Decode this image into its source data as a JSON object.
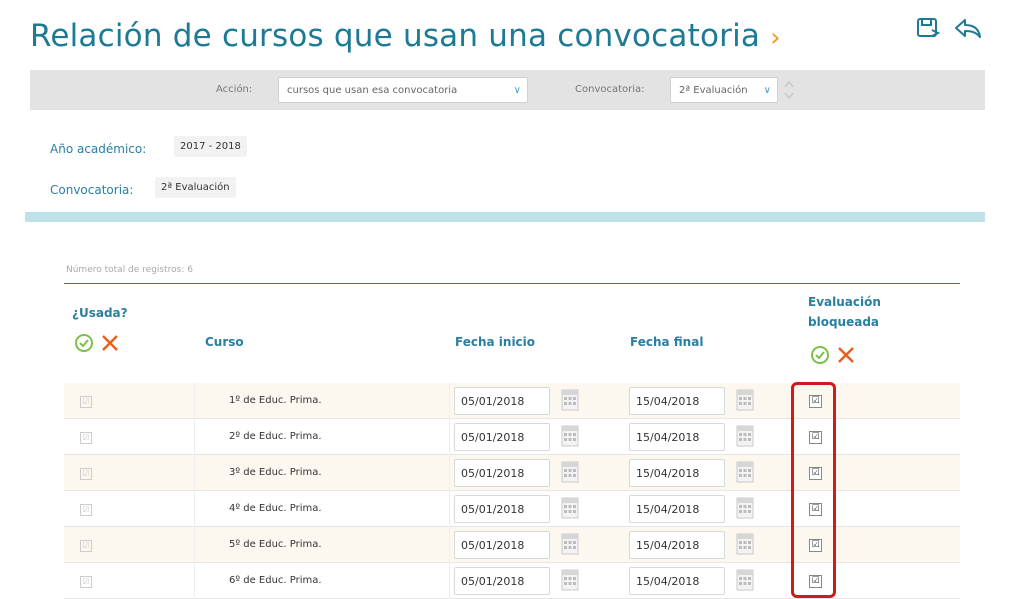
{
  "header": {
    "title": "Relación de cursos que usan una convocatoria",
    "chevron": "›"
  },
  "icons": {
    "save": "save-icon",
    "back": "back-arrow-icon",
    "accept": "check-circle-icon",
    "reject": "x-icon",
    "calendar": "calendar-icon"
  },
  "toolbar": {
    "accion_label": "Acción:",
    "accion_value": "cursos que usan esa convocatoria",
    "convocatoria_label": "Convocatoria:",
    "convocatoria_value": "2ª Evaluación",
    "chevron": "∨"
  },
  "info": {
    "anio_label": "Año académico:",
    "anio_value": "2017 - 2018",
    "conv_label": "Convocatoria:",
    "conv_value": "2ª Evaluación"
  },
  "table": {
    "total_label": "Número total de registros: 6",
    "headers": {
      "usada": "¿Usada?",
      "curso": "Curso",
      "fecha_inicio": "Fecha inicio",
      "fecha_final": "Fecha final",
      "evaluacion_line1": "Evaluación",
      "evaluacion_line2": "bloqueada"
    },
    "rows": [
      {
        "curso": "1º de Educ. Prima.",
        "inicio": "05/01/2018",
        "final": "15/04/2018",
        "check": "☑"
      },
      {
        "curso": "2º de Educ. Prima.",
        "inicio": "05/01/2018",
        "final": "15/04/2018",
        "check": "☑"
      },
      {
        "curso": "3º de Educ. Prima.",
        "inicio": "05/01/2018",
        "final": "15/04/2018",
        "check": "☑"
      },
      {
        "curso": "4º de Educ. Prima.",
        "inicio": "05/01/2018",
        "final": "15/04/2018",
        "check": "☑"
      },
      {
        "curso": "5º de Educ. Prima.",
        "inicio": "05/01/2018",
        "final": "15/04/2018",
        "check": "☑"
      },
      {
        "curso": "6º de Educ. Prima.",
        "inicio": "05/01/2018",
        "final": "15/04/2018",
        "check": "☑"
      }
    ]
  },
  "colors": {
    "title": "#1d7a95",
    "accent_orange": "#f59c1a",
    "check_green": "#7cc04b",
    "x_orange": "#e8601c",
    "highlight_red": "#d11a1a",
    "divider": "#bfe2ea"
  }
}
